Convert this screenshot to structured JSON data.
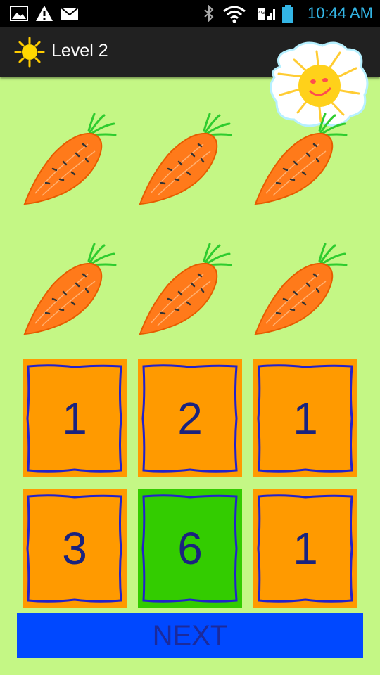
{
  "status_bar": {
    "time": "10:44 AM",
    "icons": [
      "gallery-icon",
      "warning-icon",
      "mail-icon",
      "bluetooth-icon",
      "wifi-icon",
      "signal-icon",
      "battery-icon"
    ],
    "accent_color": "#33b5e5"
  },
  "action_bar": {
    "title": "Level 2",
    "icon": "sun-icon"
  },
  "carrot_count": 6,
  "answers": {
    "tiles": [
      "1",
      "2",
      "1",
      "3",
      "6",
      "1"
    ],
    "selected_value": "6"
  },
  "next_button": {
    "label": "NEXT"
  },
  "colors": {
    "background": "#c4f785",
    "tile": "#ff9a00",
    "tile_selected": "#33cc00",
    "tile_text": "#1a237e",
    "next_button": "#0048ff"
  }
}
